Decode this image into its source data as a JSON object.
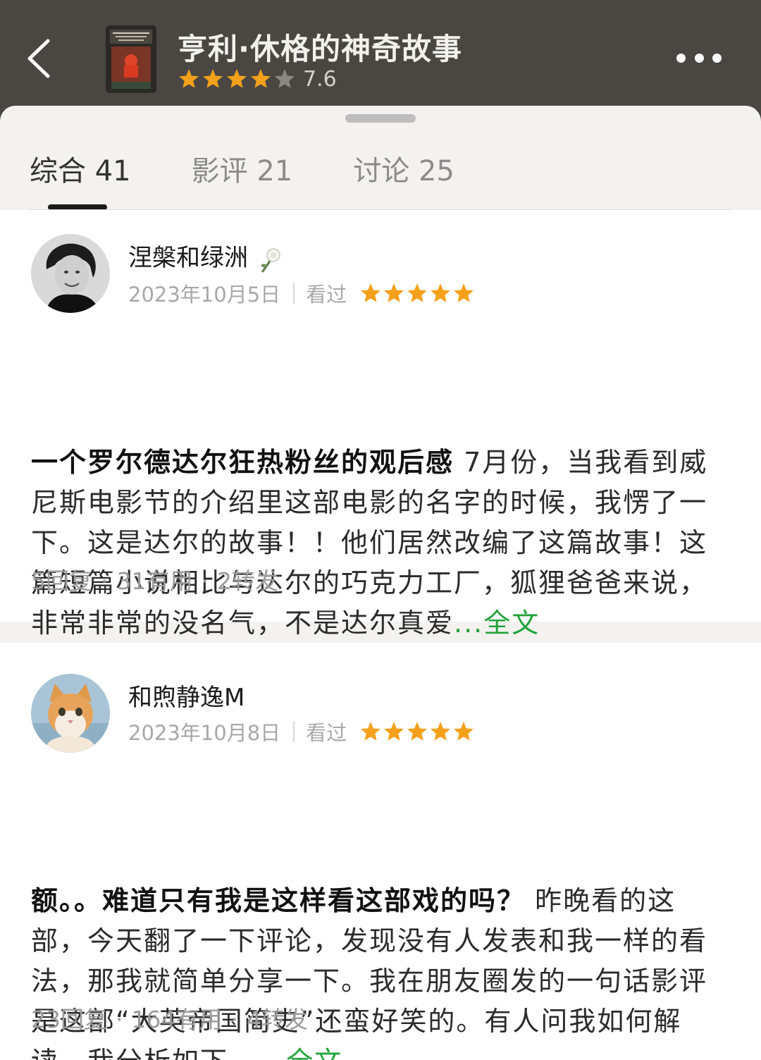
{
  "header": {
    "title": "亨利·休格的神奇故事",
    "score": "7.6",
    "rating_stars": 4
  },
  "tabs": [
    {
      "label": "综合",
      "count": "41",
      "active": true
    },
    {
      "label": "影评",
      "count": "21",
      "active": false
    },
    {
      "label": "讨论",
      "count": "25",
      "active": false
    }
  ],
  "reviews": [
    {
      "author": "涅槃和绿洲",
      "date": "2023年10月5日",
      "status": "看过",
      "stars": 5,
      "headline": "一个罗尔德达尔狂热粉丝的观后感",
      "text": "7月份，当我看到威尼斯电影节的介绍里这部电影的名字的时候，我愣了一下。这是达尔的故事！！他们居然改编了这篇故事！这篇短篇小说相比与达尔的巧克力工厂，狐狸爸爸来说，非常非常的没名气，不是达尔真爱",
      "more": "...全文",
      "replies": "5回复",
      "useful": "31有用",
      "shares": "2转发"
    },
    {
      "author": "和煦静逸M",
      "date": "2023年10月8日",
      "status": "看过",
      "stars": 5,
      "headline": "额。。难道只有我是这样看这部戏的吗？",
      "text": "昨晚看的这部，今天翻了一下评论，发现没有人发表和我一样的看法，那我就简单分享一下。我在朋友圈发的一句话影评是这部“大英帝国简史”还蛮好笑的。有人问我如何解读，我分析如下。",
      "more": "...全文",
      "replies": "23回复",
      "useful": "164有用",
      "shares": "4转发"
    }
  ],
  "colors": {
    "header_bg": "#4a4743",
    "star": "#f5a01b",
    "link": "#22a33a"
  }
}
